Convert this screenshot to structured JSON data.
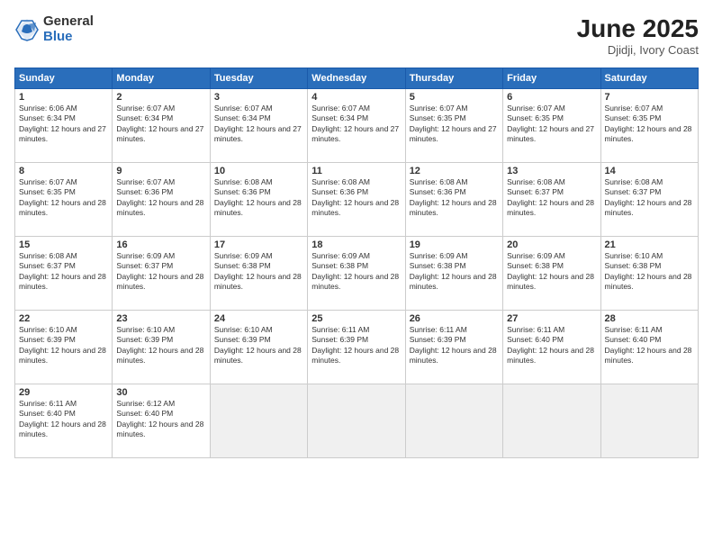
{
  "logo": {
    "general": "General",
    "blue": "Blue"
  },
  "title": "June 2025",
  "location": "Djidji, Ivory Coast",
  "days_of_week": [
    "Sunday",
    "Monday",
    "Tuesday",
    "Wednesday",
    "Thursday",
    "Friday",
    "Saturday"
  ],
  "weeks": [
    [
      {
        "day": 1,
        "sunrise": "6:06 AM",
        "sunset": "6:34 PM",
        "daylight": "12 hours and 27 minutes."
      },
      {
        "day": 2,
        "sunrise": "6:07 AM",
        "sunset": "6:34 PM",
        "daylight": "12 hours and 27 minutes."
      },
      {
        "day": 3,
        "sunrise": "6:07 AM",
        "sunset": "6:34 PM",
        "daylight": "12 hours and 27 minutes."
      },
      {
        "day": 4,
        "sunrise": "6:07 AM",
        "sunset": "6:34 PM",
        "daylight": "12 hours and 27 minutes."
      },
      {
        "day": 5,
        "sunrise": "6:07 AM",
        "sunset": "6:35 PM",
        "daylight": "12 hours and 27 minutes."
      },
      {
        "day": 6,
        "sunrise": "6:07 AM",
        "sunset": "6:35 PM",
        "daylight": "12 hours and 27 minutes."
      },
      {
        "day": 7,
        "sunrise": "6:07 AM",
        "sunset": "6:35 PM",
        "daylight": "12 hours and 28 minutes."
      }
    ],
    [
      {
        "day": 8,
        "sunrise": "6:07 AM",
        "sunset": "6:35 PM",
        "daylight": "12 hours and 28 minutes."
      },
      {
        "day": 9,
        "sunrise": "6:07 AM",
        "sunset": "6:36 PM",
        "daylight": "12 hours and 28 minutes."
      },
      {
        "day": 10,
        "sunrise": "6:08 AM",
        "sunset": "6:36 PM",
        "daylight": "12 hours and 28 minutes."
      },
      {
        "day": 11,
        "sunrise": "6:08 AM",
        "sunset": "6:36 PM",
        "daylight": "12 hours and 28 minutes."
      },
      {
        "day": 12,
        "sunrise": "6:08 AM",
        "sunset": "6:36 PM",
        "daylight": "12 hours and 28 minutes."
      },
      {
        "day": 13,
        "sunrise": "6:08 AM",
        "sunset": "6:37 PM",
        "daylight": "12 hours and 28 minutes."
      },
      {
        "day": 14,
        "sunrise": "6:08 AM",
        "sunset": "6:37 PM",
        "daylight": "12 hours and 28 minutes."
      }
    ],
    [
      {
        "day": 15,
        "sunrise": "6:08 AM",
        "sunset": "6:37 PM",
        "daylight": "12 hours and 28 minutes."
      },
      {
        "day": 16,
        "sunrise": "6:09 AM",
        "sunset": "6:37 PM",
        "daylight": "12 hours and 28 minutes."
      },
      {
        "day": 17,
        "sunrise": "6:09 AM",
        "sunset": "6:38 PM",
        "daylight": "12 hours and 28 minutes."
      },
      {
        "day": 18,
        "sunrise": "6:09 AM",
        "sunset": "6:38 PM",
        "daylight": "12 hours and 28 minutes."
      },
      {
        "day": 19,
        "sunrise": "6:09 AM",
        "sunset": "6:38 PM",
        "daylight": "12 hours and 28 minutes."
      },
      {
        "day": 20,
        "sunrise": "6:09 AM",
        "sunset": "6:38 PM",
        "daylight": "12 hours and 28 minutes."
      },
      {
        "day": 21,
        "sunrise": "6:10 AM",
        "sunset": "6:38 PM",
        "daylight": "12 hours and 28 minutes."
      }
    ],
    [
      {
        "day": 22,
        "sunrise": "6:10 AM",
        "sunset": "6:39 PM",
        "daylight": "12 hours and 28 minutes."
      },
      {
        "day": 23,
        "sunrise": "6:10 AM",
        "sunset": "6:39 PM",
        "daylight": "12 hours and 28 minutes."
      },
      {
        "day": 24,
        "sunrise": "6:10 AM",
        "sunset": "6:39 PM",
        "daylight": "12 hours and 28 minutes."
      },
      {
        "day": 25,
        "sunrise": "6:11 AM",
        "sunset": "6:39 PM",
        "daylight": "12 hours and 28 minutes."
      },
      {
        "day": 26,
        "sunrise": "6:11 AM",
        "sunset": "6:39 PM",
        "daylight": "12 hours and 28 minutes."
      },
      {
        "day": 27,
        "sunrise": "6:11 AM",
        "sunset": "6:40 PM",
        "daylight": "12 hours and 28 minutes."
      },
      {
        "day": 28,
        "sunrise": "6:11 AM",
        "sunset": "6:40 PM",
        "daylight": "12 hours and 28 minutes."
      }
    ],
    [
      {
        "day": 29,
        "sunrise": "6:11 AM",
        "sunset": "6:40 PM",
        "daylight": "12 hours and 28 minutes."
      },
      {
        "day": 30,
        "sunrise": "6:12 AM",
        "sunset": "6:40 PM",
        "daylight": "12 hours and 28 minutes."
      },
      null,
      null,
      null,
      null,
      null
    ]
  ]
}
